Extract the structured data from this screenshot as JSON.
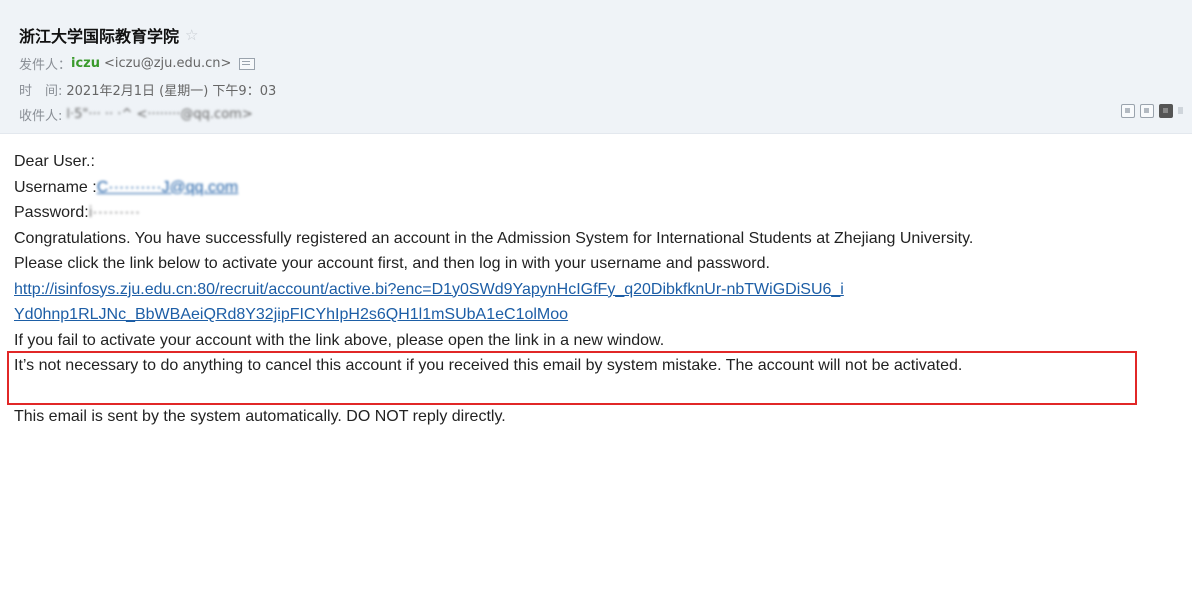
{
  "header": {
    "subject": "浙江大学国际教育学院",
    "from_label": "发件人：",
    "from_name": "iczu",
    "from_email": "<iczu@zju.edu.cn>",
    "time_label": "时　间:",
    "time_value": "2021年2月1日 (星期一) 下午9：03",
    "to_label": "收件人:",
    "to_value": "l·5\"··· ·· ·^ <········@qq.com>"
  },
  "email_body": {
    "greeting": "Dear User.:",
    "username_label": "Username :",
    "username_value": "C··········J@qq.com",
    "password_label": "Password:",
    "password_value": "i·········",
    "line_congrats": "Congratulations. You have successfully registered an account in the Admission System for International Students at Zhejiang University.",
    "line_instruction": "Please click the link below to activate your account first, and then log in with your username and password.",
    "activation_link": "http://isinfosys.zju.edu.cn:80/recruit/account/active.bi?enc=D1y0SWd9YapynHcIGfFy_q20DibkfknUr-nbTWiGDiSU6_iYd0hnp1RLJNc_BbWBAeiQRd8Y32jipFICYhIpH2s6QH1l1mSUbA1eC1olMoo",
    "activation_link_line1": "http://isinfosys.zju.edu.cn:80/recruit/account/active.bi?enc=D1y0SWd9YapynHcIGfFy_q20DibkfknUr-nbTWiGDiSU6_i",
    "activation_link_line2": "Yd0hnp1RLJNc_BbWBAeiQRd8Y32jipFICYhIpH2s6QH1l1mSUbA1eC1olMoo",
    "line_fail": "If you fail to activate your account with the link above, please open the link in a new window.",
    "line_cancel": "It’s not necessary to do anything to cancel this account if you received this email by system mistake. The account will not be activated.",
    "line_auto": "This email is sent by the system automatically. DO NOT reply directly."
  },
  "icons": {
    "star": "star-icon",
    "contact_card": "contact-card-icon",
    "toolbar": [
      "view-icon",
      "download-icon",
      "print-icon",
      "more-icon"
    ]
  },
  "colors": {
    "header_bg": "#eff3f7",
    "sender_name": "#3a9a2c",
    "link": "#1d5ea6",
    "highlight_box": "#e12727"
  }
}
